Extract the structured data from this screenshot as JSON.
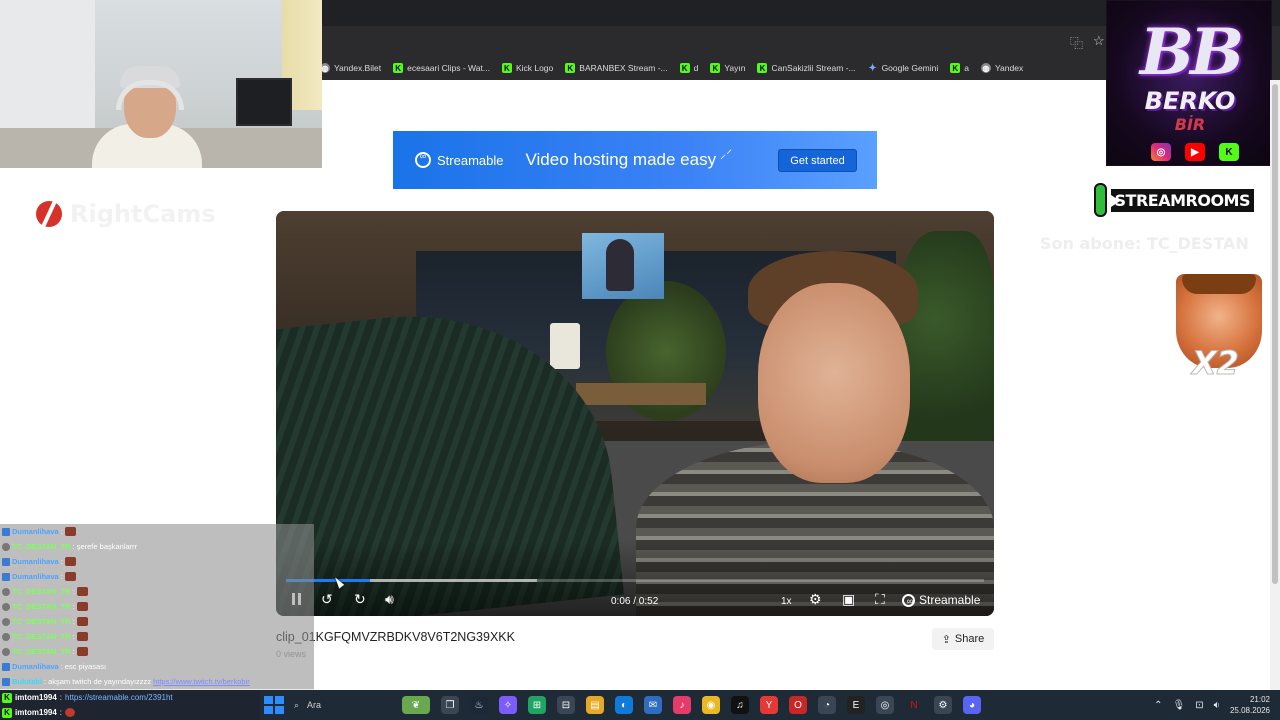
{
  "bookmarks": [
    {
      "label": "Yandex.Bilet",
      "icon": "generic-icon"
    },
    {
      "label": "ecesaari Clips - Wat...",
      "icon": "kick-icon"
    },
    {
      "label": "Kick Logo",
      "icon": "kick-icon"
    },
    {
      "label": "BARANBEX Stream -...",
      "icon": "kick-icon"
    },
    {
      "label": "d",
      "icon": "kick-icon"
    },
    {
      "label": "Yayın",
      "icon": "kick-icon"
    },
    {
      "label": "CanSakizlii Stream -...",
      "icon": "kick-icon"
    },
    {
      "label": "Google Gemini",
      "icon": "gemini-icon"
    },
    {
      "label": "a",
      "icon": "kick-icon"
    },
    {
      "label": "Yandex",
      "icon": "generic-icon"
    }
  ],
  "overlay": {
    "bb_letters": "BB",
    "bb_name": "BERKO",
    "bb_sub": "BİR",
    "streamrooms": "STREAMROOMS",
    "x2": "X2",
    "ghost_logo": "RightCams",
    "ghost_sub": "Son abone: TC_DESTAN"
  },
  "banner": {
    "brand": "Streamable",
    "tagline": "Video hosting made easy",
    "cta": "Get started"
  },
  "player": {
    "time": "0:06 / 0:52",
    "speed": "1x",
    "brand": "Streamable",
    "progress_played": 0.12,
    "progress_buffered": 0.36
  },
  "clip": {
    "title": "clip_01KGFQMVZRBDKV8V6T2NG39XKK",
    "views": "0 views",
    "share": "Share"
  },
  "chat": {
    "rows": [
      {
        "user": "Dumanlihava",
        "sep": ":",
        "msg": "",
        "color": "blue",
        "badge": "b",
        "emote": true
      },
      {
        "user": "TC_DESTAN_TR",
        "sep": ":",
        "msg": "şerefe başkanlarrr",
        "color": "green",
        "badge": "g",
        "emote": false
      },
      {
        "user": "Dumanlihava",
        "sep": ":",
        "msg": "",
        "color": "blue",
        "badge": "b",
        "emote": true
      },
      {
        "user": "Dumanlihava",
        "sep": ":",
        "msg": "",
        "color": "blue",
        "badge": "b",
        "emote": true
      },
      {
        "user": "TC_DESTAN_TR",
        "sep": ":",
        "msg": "",
        "color": "green",
        "badge": "g",
        "emote": true
      },
      {
        "user": "TC_DESTAN_TR",
        "sep": ":",
        "msg": "",
        "color": "green",
        "badge": "g",
        "emote": true
      },
      {
        "user": "TC_DESTAN_TR",
        "sep": ":",
        "msg": "",
        "color": "green",
        "badge": "g",
        "emote": true
      },
      {
        "user": "TC_DESTAN_TR",
        "sep": ":",
        "msg": "",
        "color": "green",
        "badge": "g",
        "emote": true
      },
      {
        "user": "TC_DESTAN_TR",
        "sep": ":",
        "msg": "",
        "color": "green",
        "badge": "g",
        "emote": true
      },
      {
        "user": "Dumanlihava",
        "sep": ":",
        "msg": "esc piyasası",
        "color": "blue",
        "badge": "b",
        "emote": false
      },
      {
        "user": "Bulutabi",
        "sep": ":",
        "msg": "akşam twitch de yayındayızzzz",
        "link": "https://www.twitch.tv/berkobir",
        "color": "cyan",
        "badge": "b",
        "emote": false
      }
    ],
    "footer": [
      {
        "user": "imtom1994",
        "sep": ":",
        "link": "https://streamable.com/2391ht"
      },
      {
        "user": "imtom1994",
        "sep": ":",
        "link": ""
      }
    ]
  },
  "taskbar": {
    "search": "Ara",
    "time": "21:02",
    "date": "25.08.2026"
  }
}
